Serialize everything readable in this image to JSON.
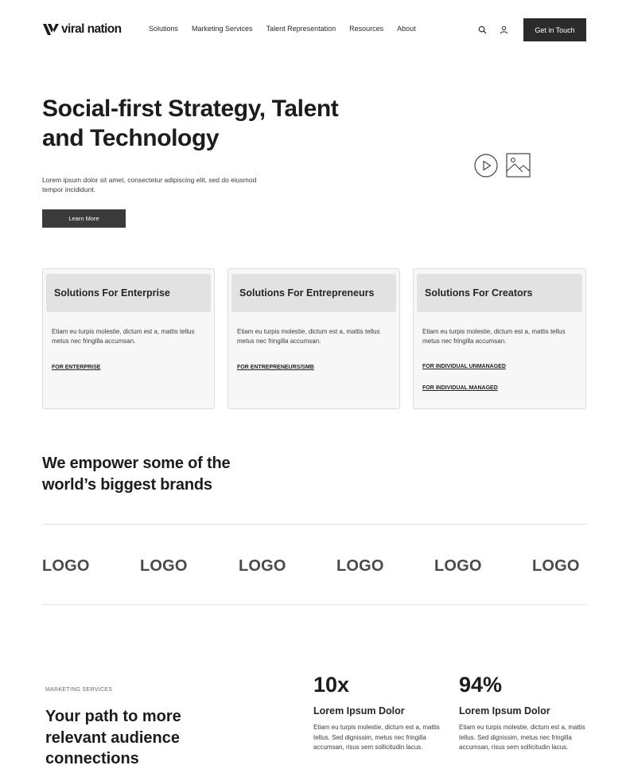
{
  "header": {
    "brand": "viral nation",
    "nav": [
      "Solutions",
      "Marketing Services",
      "Talent Representation",
      "Resources",
      "About"
    ],
    "cta": "Get in Touch"
  },
  "hero": {
    "title_line1": "Social-first Strategy, Talent",
    "title_line2": "and Technology",
    "description": "Lorem ipsum dolor sit amet, consectetur adipiscing elit, sed do eiusmod tempor incididunt.",
    "button": "Learn More"
  },
  "cards": [
    {
      "title": "Solutions For Enterprise",
      "description": "Etiam eu turpis molestie, dictum est a, mattis tellus metus nec fringilla accumsan.",
      "links": [
        "FOR ENTERPRISE"
      ]
    },
    {
      "title": "Solutions For Entrepreneurs",
      "description": "Etiam eu turpis molestie, dictum est a, mattis tellus metus nec fringilla accumsan.",
      "links": [
        "FOR ENTREPRENEURS/SMB"
      ]
    },
    {
      "title": "Solutions For Creators",
      "description": "Etiam eu turpis molestie, dictum est a, mattis tellus metus nec fringilla accumsan.",
      "links": [
        "FOR INDIVIDUAL UNMANAGED",
        "FOR INDIVIDUAL MANAGED"
      ]
    }
  ],
  "brands": {
    "title_line1": "We empower some of the",
    "title_line2": "world’s biggest brands",
    "logos": [
      "LOGO",
      "LOGO",
      "LOGO",
      "LOGO",
      "LOGO",
      "LOGO"
    ]
  },
  "marketing": {
    "eyebrow": "MARKETING SERVICES",
    "title_line1": "Your path to more",
    "title_line2": "relevant audience",
    "title_line3": "connections",
    "stats": [
      {
        "value": "10x",
        "label": "Lorem Ipsum Dolor",
        "description": "Etiam eu turpis molestie, dictum est a, mattis tellus. Sed dignissim, metus nec fringilla accumsan, risus sem sollicitudin lacus."
      },
      {
        "value": "94%",
        "label": "Lorem Ipsum Dolor",
        "description": "Etiam eu turpis molestie, dictum est a, mattis tellus. Sed dignissim, metus nec fringilla accumsan, risus sem sollicitudin lacus."
      }
    ]
  },
  "icons": {
    "search": "search-icon",
    "user": "user-icon",
    "play": "play-icon",
    "image": "image-icon"
  },
  "colors": {
    "primary_button": "#2b2b2b",
    "card_background": "#f7f7f7",
    "card_header": "#e2e2e2"
  }
}
